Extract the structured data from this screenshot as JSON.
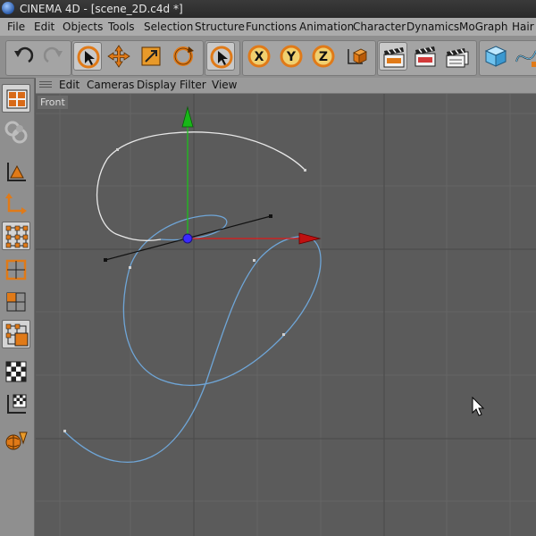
{
  "app": {
    "title": "CINEMA 4D - [scene_2D.c4d *]"
  },
  "menu": {
    "items": [
      "File",
      "Edit",
      "Objects",
      "Tools",
      "Selection",
      "Structure",
      "Functions",
      "Animation",
      "Character",
      "Dynamics",
      "MoGraph",
      "Hair"
    ]
  },
  "toolbar": {
    "buttons": [
      "undo-icon",
      "redo-icon",
      "live-selection-icon",
      "move-icon",
      "scale-icon",
      "rotate-icon",
      "select-icon",
      "x-axis-icon",
      "y-axis-icon",
      "z-axis-icon",
      "coordinate-system-icon",
      "render-view-icon",
      "render-picture-viewer-icon",
      "render-settings-icon",
      "cube-icon",
      "spline-icon"
    ],
    "axis_labels": [
      "X",
      "Y",
      "Z"
    ]
  },
  "left_toolbar": {
    "buttons": [
      "viewport-layout-icon",
      "use-mode-icon",
      "model-mode-icon",
      "object-axis-icon",
      "points-mode-icon",
      "edges-mode-icon",
      "polygons-mode-icon",
      "polygon-edit-icon",
      "texture-mode-icon",
      "texture-axis-icon",
      "animation-mode-icon"
    ]
  },
  "viewport": {
    "menu": [
      "Edit",
      "Cameras",
      "Display",
      "Filter",
      "View"
    ],
    "label": "Front"
  },
  "colors": {
    "spline_selected": "#e8e8e8",
    "spline_curve": "#6fa6d8",
    "axis_x": "#e01818",
    "axis_y": "#18c818",
    "axis_center": "#3a2aff",
    "accent_orange": "#e07a18"
  }
}
